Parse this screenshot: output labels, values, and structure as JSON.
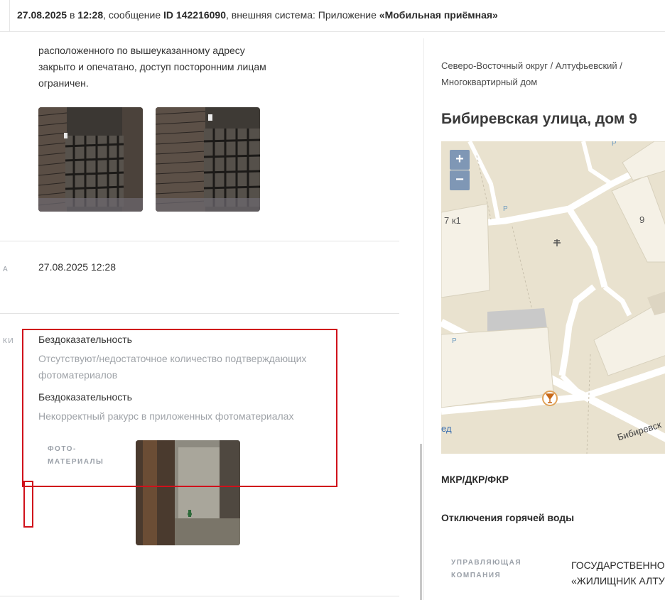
{
  "header": {
    "date": "27.08.2025",
    "in_word": "в",
    "time": "12:28",
    "message_prefix": ", сообщение",
    "message_id": "ID 142216090",
    "external_prefix": ", внешняя система: Приложение",
    "app_name": "«Мобильная приёмная»"
  },
  "left": {
    "description_lines": [
      "расположенного по вышеуказанному адресу",
      "закрыто и опечатано, доступ посторонним лицам",
      "ограничен."
    ],
    "date_label": "А",
    "date_value": "27.08.2025 12:28",
    "verdict_label": "КИ",
    "verdicts": [
      {
        "title": "Бездоказательность",
        "reason": "Отсутствуют/недостаточное количество подтверждающих фотоматериалов"
      },
      {
        "title": "Бездоказательность",
        "reason": "Некорректный ракурс в приложенных фотоматериалах"
      }
    ],
    "photo_label_line1": "ФОТО-",
    "photo_label_line2": "МАТЕРИАЛЫ"
  },
  "right": {
    "breadcrumb_line1": "Северо-Восточный округ / Алтуфьевский /",
    "breadcrumb_line2": "Многоквартирный дом",
    "address": "Бибиревская улица, дом 9",
    "map": {
      "zoom_in": "+",
      "zoom_out": "−",
      "building_label_1": "7 к1",
      "building_label_2": "9",
      "parking": "P",
      "street_label": "Бибиревск",
      "street_label_2": "ед"
    },
    "section_mkr": "МКР/ДКР/ФКР",
    "section_hot_water": "Отключения горячей воды",
    "uk_label_line1": "УПРАВЛЯЮЩАЯ",
    "uk_label_line2": "КОМПАНИЯ",
    "uk_value_line1": "ГОСУДАРСТВЕННОЕ",
    "uk_value_line2": "«ЖИЛИЩНИК АЛТУФЬЕВСКОГО"
  }
}
